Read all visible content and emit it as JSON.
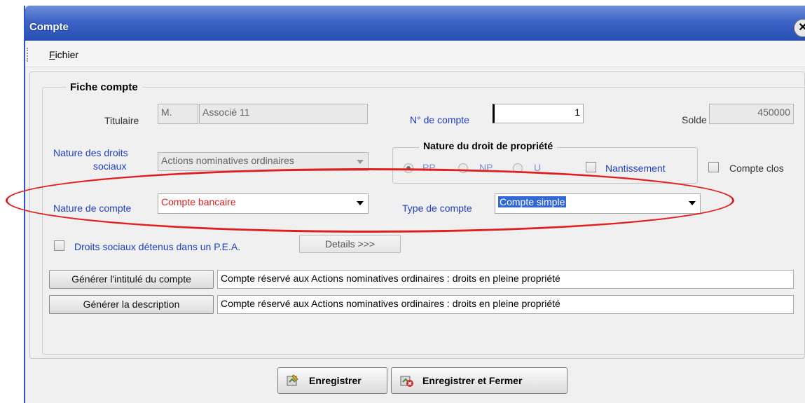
{
  "window": {
    "title": "Compte",
    "close_glyph": "✕"
  },
  "menu": {
    "items": [
      {
        "label": "Fichier",
        "mnemonic": "F"
      }
    ]
  },
  "groupbox": {
    "title": "Fiche compte"
  },
  "titulaire": {
    "label": "Titulaire",
    "civility": "M.",
    "name": "Associé 11"
  },
  "numero": {
    "label": "N° de compte",
    "value": "1"
  },
  "solde": {
    "label": "Solde",
    "value": "450000"
  },
  "nature_droits": {
    "label_line1": "Nature des droits",
    "label_line2": "sociaux",
    "value": "Actions nominatives ordinaires"
  },
  "propriete": {
    "title": "Nature du droit de propriété",
    "options": [
      {
        "label": "PP",
        "selected": true
      },
      {
        "label": "NP",
        "selected": false
      },
      {
        "label": "U",
        "selected": false
      }
    ],
    "nantissement_label": "Nantissement"
  },
  "compte_clos": {
    "label": "Compte clos",
    "checked": false
  },
  "nature_compte": {
    "label": "Nature de compte",
    "value": "Compte bancaire",
    "color": "#e02020"
  },
  "type_compte": {
    "label": "Type de compte",
    "value": "Compte simple"
  },
  "pea": {
    "label": "Droits sociaux détenus dans un P.E.A.",
    "checked": false,
    "details_label": "Details >>>"
  },
  "intitule": {
    "button": "Générer l'intitulé du compte",
    "value": "Compte réservé aux Actions nominatives ordinaires : droits en pleine propriété"
  },
  "description": {
    "button": "Générer la description",
    "value": "Compte réservé aux Actions nominatives ordinaires : droits en pleine propriété"
  },
  "footer": {
    "save_label": "Enregistrer",
    "save_close_label": "Enregistrer et Fermer"
  },
  "colors": {
    "title_bar": "#3d63c6",
    "label_blue": "#1e3ec8",
    "highlight": "#3167d6",
    "annotation": "#e02020"
  }
}
